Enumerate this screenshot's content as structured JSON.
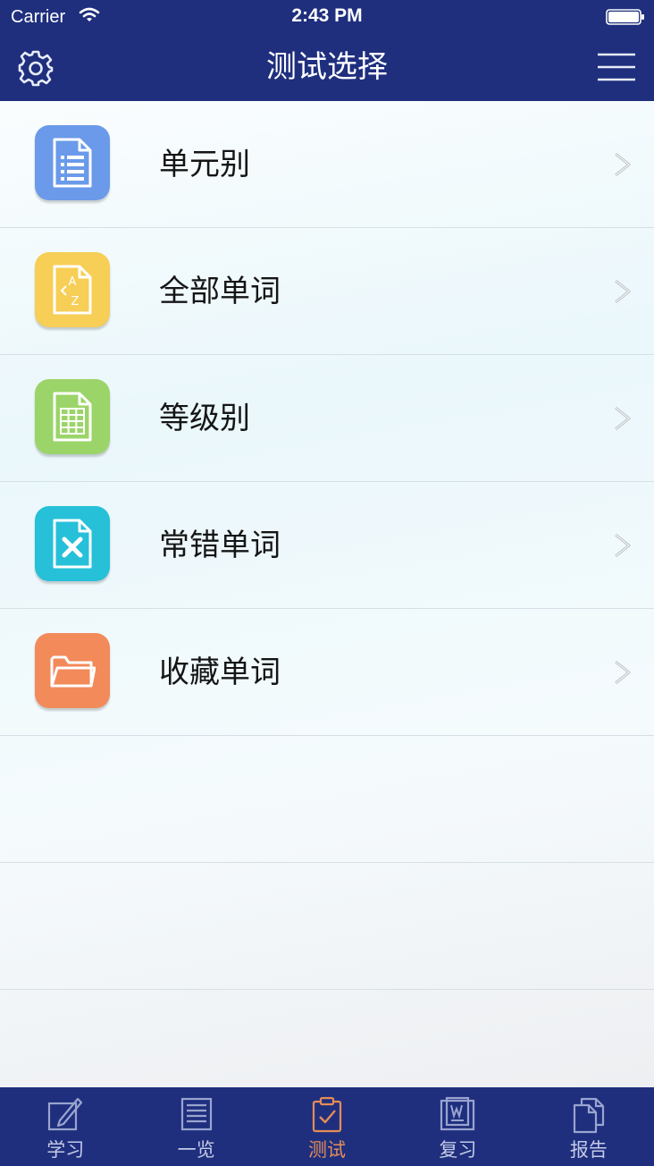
{
  "status_bar": {
    "carrier": "Carrier",
    "time": "2:43 PM",
    "wifi_icon": "wifi-icon",
    "battery_icon": "battery-full-icon"
  },
  "nav": {
    "title": "测试选择",
    "left_icon": "gear-icon",
    "right_icon": "hamburger-menu-icon"
  },
  "menu_items": [
    {
      "label": "单元别",
      "icon": "document-list-icon",
      "icon_color": "#6a9ae9"
    },
    {
      "label": "全部单词",
      "icon": "az-document-icon",
      "icon_color": "#f7ce56"
    },
    {
      "label": "等级别",
      "icon": "grid-document-icon",
      "icon_color": "#9bd468"
    },
    {
      "label": "常错单词",
      "icon": "error-document-icon",
      "icon_color": "#26c0d8"
    },
    {
      "label": "收藏单词",
      "icon": "folder-icon",
      "icon_color": "#f28a5a"
    }
  ],
  "az_icon_letters": {
    "top": "A",
    "bottom": "Z"
  },
  "tabs": [
    {
      "label": "学习",
      "icon": "pencil-note-icon",
      "active": false
    },
    {
      "label": "一览",
      "icon": "list-document-icon",
      "active": false
    },
    {
      "label": "测试",
      "icon": "clipboard-check-icon",
      "active": true
    },
    {
      "label": "复习",
      "icon": "book-review-icon",
      "active": false
    },
    {
      "label": "报告",
      "icon": "report-pages-icon",
      "active": false
    }
  ],
  "colors": {
    "nav_background": "#1f2f7e",
    "active_tab": "#e58c58",
    "inactive_tab": "#c4cbe6"
  }
}
